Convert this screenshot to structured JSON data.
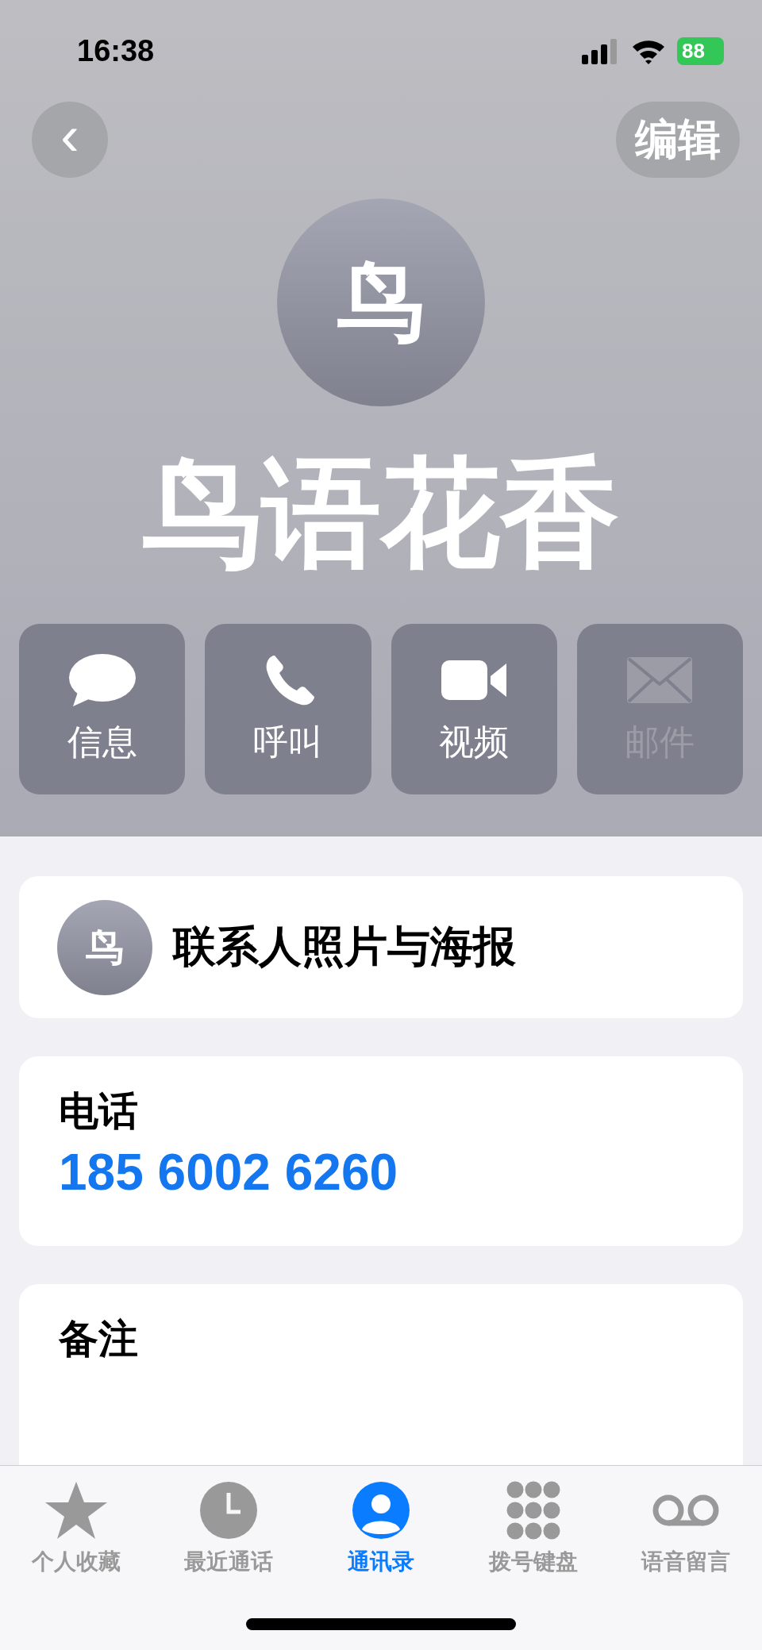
{
  "status_bar": {
    "time": "16:38",
    "battery": "88"
  },
  "nav": {
    "back": "‹",
    "edit": "编辑"
  },
  "contact": {
    "avatar_initial": "鸟",
    "name": "鸟语花香"
  },
  "actions": [
    {
      "kind": "message",
      "label": "信息",
      "disabled": false
    },
    {
      "kind": "phone",
      "label": "呼叫",
      "disabled": false
    },
    {
      "kind": "video",
      "label": "视频",
      "disabled": false
    },
    {
      "kind": "mail",
      "label": "邮件",
      "disabled": true
    }
  ],
  "poster_card": {
    "avatar_initial": "鸟",
    "label": "联系人照片与海报"
  },
  "phone_card": {
    "label": "电话",
    "number": "185 6002 6260"
  },
  "notes_card": {
    "label": "备注"
  },
  "tabs": [
    {
      "kind": "favorites",
      "label": "个人收藏",
      "selected": false
    },
    {
      "kind": "recents",
      "label": "最近通话",
      "selected": false
    },
    {
      "kind": "contacts",
      "label": "通讯录",
      "selected": true
    },
    {
      "kind": "keypad",
      "label": "拨号键盘",
      "selected": false
    },
    {
      "kind": "voicemail",
      "label": "语音留言",
      "selected": false
    }
  ]
}
